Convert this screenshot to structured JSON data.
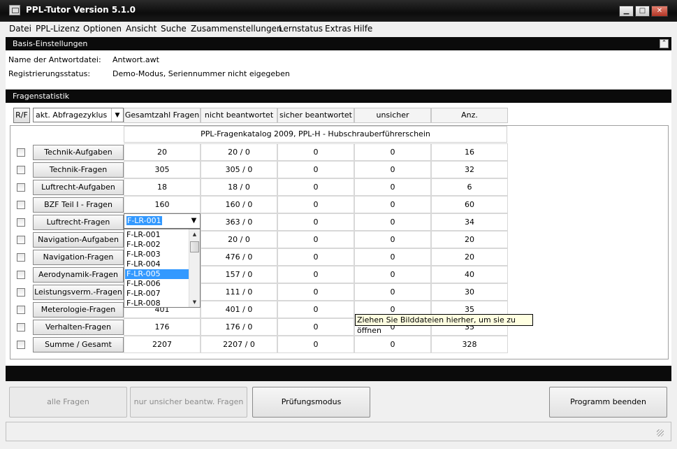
{
  "window": {
    "title": "PPL-Tutor Version 5.1.0",
    "minimize": "▁",
    "maximize": "□",
    "close": "✕"
  },
  "menu": [
    "Datei",
    "PPL-Lizenz",
    "Optionen",
    "Ansicht",
    "Suche",
    "Zusammenstellungen",
    "Lernstatus",
    "Extras",
    "Hilfe"
  ],
  "basis": {
    "header": "Basis-Einstellungen",
    "answer_file_label": "Name der Antwortdatei:",
    "answer_file_value": "Antwort.awt",
    "registration_label": "Registrierungsstatus:",
    "registration_value": "Demo-Modus, Seriennummer nicht eigegeben"
  },
  "stats": {
    "header": "Fragenstatistik",
    "rf_button": "R/F",
    "cycle_combo": "akt. Abfragezyklus",
    "columns": [
      "Gesamtzahl Fragen",
      "nicht beantwortet",
      "sicher beantwortet",
      "unsicher beantwortet",
      "Anz. Prüfungsfragen"
    ],
    "catalog_title": "PPL-Fragenkatalog 2009, PPL-H - Hubschrauberführerschein",
    "rows": [
      {
        "label": "Technik-Aufgaben",
        "total": "20",
        "open": "20 / 0",
        "sure": "0",
        "unsure": "0",
        "exam": "16"
      },
      {
        "label": "Technik-Fragen",
        "total": "305",
        "open": "305 / 0",
        "sure": "0",
        "unsure": "0",
        "exam": "32"
      },
      {
        "label": "Luftrecht-Aufgaben",
        "total": "18",
        "open": "18 / 0",
        "sure": "0",
        "unsure": "0",
        "exam": "6"
      },
      {
        "label": "BZF Teil I - Fragen",
        "total": "160",
        "open": "160 / 0",
        "sure": "0",
        "unsure": "0",
        "exam": "60"
      },
      {
        "label": "Luftrecht-Fragen",
        "total": "",
        "open": "363 / 0",
        "sure": "0",
        "unsure": "0",
        "exam": "34"
      },
      {
        "label": "Navigation-Aufgaben",
        "total": "",
        "open": "20 / 0",
        "sure": "0",
        "unsure": "0",
        "exam": "20"
      },
      {
        "label": "Navigation-Fragen",
        "total": "",
        "open": "476 / 0",
        "sure": "0",
        "unsure": "0",
        "exam": "20"
      },
      {
        "label": "Aerodynamik-Fragen",
        "total": "",
        "open": "157 / 0",
        "sure": "0",
        "unsure": "0",
        "exam": "40"
      },
      {
        "label": "Leistungsverm.-Fragen",
        "total": "",
        "open": "111 / 0",
        "sure": "0",
        "unsure": "0",
        "exam": "30"
      },
      {
        "label": "Meterologie-Fragen",
        "total": "401",
        "open": "401 / 0",
        "sure": "0",
        "unsure": "0",
        "exam": "35"
      },
      {
        "label": "Verhalten-Fragen",
        "total": "176",
        "open": "176 / 0",
        "sure": "0",
        "unsure": "0",
        "exam": "35"
      },
      {
        "label": "Summe / Gesamt",
        "total": "2207",
        "open": "2207 / 0",
        "sure": "0",
        "unsure": "0",
        "exam": "328"
      }
    ],
    "dropdown": {
      "value": "F-LR-001",
      "arrow": "▼",
      "items": [
        "F-LR-001",
        "F-LR-002",
        "F-LR-003",
        "F-LR-004",
        "F-LR-005",
        "F-LR-006",
        "F-LR-007",
        "F-LR-008"
      ],
      "selected_index": 4
    },
    "tooltip": "Ziehen Sie Bilddateien hierher, um sie zu öffnen"
  },
  "buttons": {
    "all_questions": "alle Fragen",
    "only_unsure": "nur unsicher beantw. Fragen",
    "exam_mode": "Prüfungsmodus",
    "quit": "Programm beenden"
  }
}
